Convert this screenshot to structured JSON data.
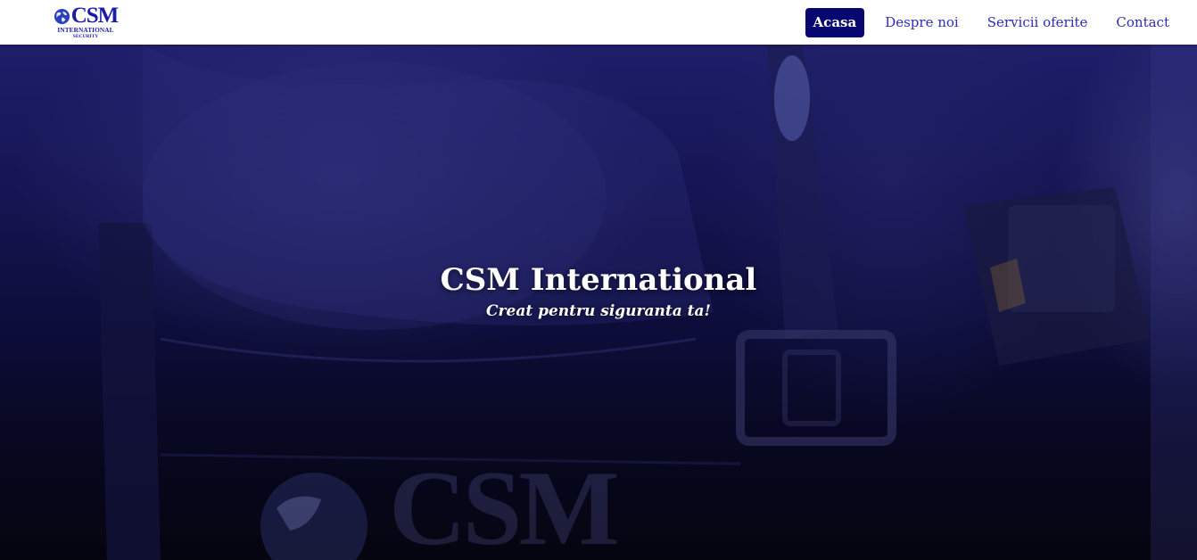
{
  "logo": {
    "word": "CSM",
    "line1": "INTERNATIONAL",
    "line2": "SECURITY"
  },
  "nav": {
    "items": [
      {
        "label": "Acasa",
        "active": true
      },
      {
        "label": "Despre noi",
        "active": false
      },
      {
        "label": "Servicii oferite",
        "active": false
      },
      {
        "label": "Contact",
        "active": false
      }
    ]
  },
  "hero": {
    "title": "CSM International",
    "subtitle": "Creat pentru siguranta ta!",
    "background_emblem": "CSM"
  },
  "colors": {
    "brand": "#1b1ba8",
    "nav_active_bg": "#070770",
    "hero_tint": "#161656"
  }
}
